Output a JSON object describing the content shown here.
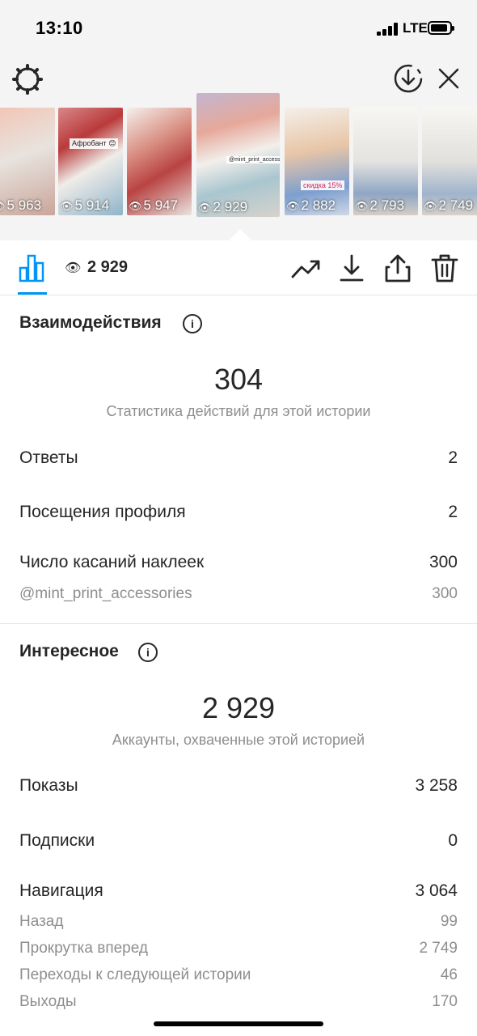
{
  "status": {
    "time": "13:10",
    "network": "LTE"
  },
  "icons": {
    "settings": "gear-icon",
    "download_circle": "download-circle-icon",
    "close": "close-icon",
    "insights_tab": "bar-chart-icon",
    "views": "eye-icon",
    "promote": "trending-up-icon",
    "download": "download-icon",
    "share": "share-icon",
    "delete": "trash-icon"
  },
  "stories": [
    {
      "views": "5 963",
      "sticker": ""
    },
    {
      "views": "5 914",
      "sticker": "Афробант 😊"
    },
    {
      "views": "5 947",
      "sticker": ""
    },
    {
      "views": "2 929",
      "sticker": "@mint_print_accessories"
    },
    {
      "views": "2 882",
      "sticker": "скидка 15%"
    },
    {
      "views": "2 793",
      "sticker": ""
    },
    {
      "views": "2 749",
      "sticker": ""
    }
  ],
  "toolbar": {
    "views_count": "2 929"
  },
  "interactions": {
    "title": "Взаимодействия",
    "info": "i",
    "total": "304",
    "caption": "Статистика действий для этой истории",
    "replies_label": "Ответы",
    "replies_value": "2",
    "profile_visits_label": "Посещения профиля",
    "profile_visits_value": "2",
    "sticker_taps_label": "Число касаний наклеек",
    "sticker_taps_value": "300",
    "sticker_account_label": "@mint_print_accessories",
    "sticker_account_value": "300"
  },
  "discovery": {
    "title": "Интересное",
    "info": "i",
    "total": "2 929",
    "caption": "Аккаунты, охваченные этой историей",
    "impressions_label": "Показы",
    "impressions_value": "3 258",
    "follows_label": "Подписки",
    "follows_value": "0",
    "navigation_label": "Навигация",
    "navigation_value": "3 064",
    "back_label": "Назад",
    "back_value": "99",
    "forward_label": "Прокрутка вперед",
    "forward_value": "2 749",
    "next_story_label": "Переходы к следующей истории",
    "next_story_value": "46",
    "exits_label": "Выходы",
    "exits_value": "170"
  },
  "colors": {
    "accent": "#0095f6",
    "text": "#262626",
    "secondary": "#8e8e8e",
    "divider": "#e6e6e6"
  }
}
